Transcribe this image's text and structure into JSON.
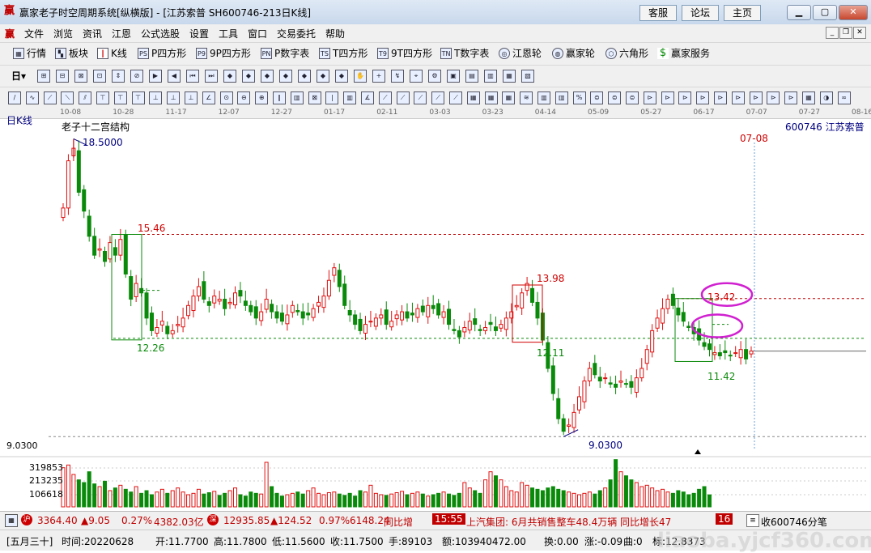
{
  "window": {
    "title": "赢家老子时空周期系统[纵横版] - [江苏索普  SH600746-213日K线]",
    "buttons": [
      "客服",
      "论坛",
      "主页"
    ]
  },
  "menu": [
    "文件",
    "浏览",
    "资讯",
    "江恩",
    "公式选股",
    "设置",
    "工具",
    "窗口",
    "交易委托",
    "帮助"
  ],
  "toolbar1": [
    "行情",
    "板块",
    "K线",
    "P四方形",
    "9P四方形",
    "P数字表",
    "T四方形",
    "9T四方形",
    "T数字表",
    "江恩轮",
    "赢家轮",
    "六角形",
    "赢家服务"
  ],
  "toolbar1_icons": [
    "PS",
    "P9",
    "PN",
    "TS",
    "T9",
    "TN"
  ],
  "date_axis": [
    "10-08",
    "10-28",
    "11-17",
    "12-07",
    "12-27",
    "01-17",
    "02-11",
    "03-03",
    "03-23",
    "04-14",
    "05-09",
    "05-27",
    "06-17",
    "07-07",
    "07-27",
    "08-16"
  ],
  "chart": {
    "period_label": "日K线",
    "indicator_name": "老子十二宫结构",
    "stock_code": "600746",
    "stock_name": "江苏索普",
    "cursor_date": "07-08",
    "price_labels": {
      "high": "18.5000",
      "box1_top": "15.46",
      "box1_bottom": "12.26",
      "box2_top": "13.98",
      "box2_bottom": "12.11",
      "box3_top": "13.42",
      "box3_bottom": "11.42",
      "low": "9.0300",
      "low_axis": "9.0300"
    },
    "volume_ticks": [
      "319853",
      "213235",
      "106618"
    ],
    "colors": {
      "up": "#e01010",
      "down": "#0a8a0a",
      "box": "#0a8a0a",
      "red_box": "#d00000",
      "highlight": "#d020d0",
      "cursor": "#6aa0d8",
      "price_line": "#c00000"
    }
  },
  "chart_data": {
    "type": "candlestick",
    "title": "老子十二宫结构",
    "series": [
      {
        "name": "price_close_path",
        "values": [
          16.3,
          17.8,
          18.2,
          16.8,
          16.2,
          15.4,
          14.8,
          15.0,
          14.6,
          15.2,
          14.8,
          15.3,
          14.2,
          13.4,
          13.9,
          13.6,
          12.8,
          12.4,
          12.5,
          12.7,
          12.3,
          12.4,
          12.6,
          12.8,
          13.2,
          13.5,
          13.8,
          13.4,
          13.2,
          13.5,
          13.4,
          13.1,
          13.3,
          13.6,
          13.5,
          13.2,
          13.0,
          12.8,
          13.0,
          13.4,
          13.0,
          12.8,
          12.7,
          12.9,
          13.2,
          13.0,
          12.8,
          12.9,
          13.1,
          13.3,
          13.5,
          14.0,
          14.4,
          13.8,
          13.2,
          12.9,
          12.6,
          12.4,
          12.6,
          12.7,
          12.8,
          12.9,
          12.6,
          12.7,
          12.9,
          13.0,
          12.8,
          12.9,
          13.1,
          13.0,
          13.2,
          13.1,
          12.9,
          13.0,
          12.6,
          12.4,
          12.2,
          12.5,
          12.7,
          12.6,
          12.4,
          12.5,
          12.6,
          12.4,
          12.6,
          12.8,
          13.0,
          13.2,
          13.6,
          13.9,
          13.3,
          12.8,
          12.1,
          11.2,
          10.4,
          9.6,
          9.2,
          9.4,
          9.8,
          10.3,
          10.8,
          11.2,
          11.0,
          10.8,
          10.9,
          10.7,
          10.6,
          10.8,
          10.7,
          10.6,
          10.9,
          11.2,
          11.8,
          12.4,
          12.8,
          13.1,
          13.4,
          13.2,
          12.9,
          12.7,
          12.5,
          12.3,
          12.1,
          11.9,
          11.8,
          11.7,
          11.6,
          11.7,
          11.6,
          11.7,
          11.8,
          11.5,
          11.75
        ]
      },
      {
        "name": "volume",
        "values": [
          290000,
          310000,
          240000,
          200000,
          180000,
          260000,
          170000,
          150000,
          190000,
          120000,
          140000,
          160000,
          130000,
          110000,
          150000,
          100000,
          120000,
          90000,
          110000,
          130000,
          100000,
          120000,
          140000,
          110000,
          90000,
          100000,
          130000,
          95000,
          105000,
          115000,
          85000,
          100000,
          120000,
          140000,
          90000,
          80000,
          110000,
          100000,
          95000,
          330000,
          150000,
          100000,
          80000,
          90000,
          100000,
          110000,
          95000,
          120000,
          140000,
          100000,
          90000,
          105000,
          110000,
          95000,
          85000,
          100000,
          80000,
          120000,
          110000,
          160000,
          100000,
          90000,
          85000,
          95000,
          105000,
          115000,
          90000,
          100000,
          110000,
          95000,
          80000,
          90000,
          100000,
          110000,
          95000,
          85000,
          100000,
          180000,
          140000,
          120000,
          100000,
          200000,
          260000,
          230000,
          200000,
          150000,
          120000,
          110000,
          180000,
          160000,
          140000,
          130000,
          120000,
          140000,
          150000,
          130000,
          120000,
          110000,
          100000,
          90000,
          100000,
          110000,
          95000,
          120000,
          140000,
          200000,
          350000,
          260000,
          230000,
          200000,
          180000,
          150000,
          160000,
          140000,
          120000,
          130000,
          110000,
          100000,
          120000,
          110000,
          90000,
          100000,
          130000,
          150000,
          89103
        ]
      }
    ],
    "ylim": [
      8.6,
      19.0
    ],
    "reference_lines": [
      15.46,
      13.42,
      12.26,
      11.75,
      9.03
    ]
  },
  "ticker": {
    "sh_index": "3364.40",
    "sh_change": "▲9.05",
    "sh_pct": "0.27%",
    "sh_amount": "4382.03亿",
    "sz_index": "12935.85",
    "sz_change": "▲124.52",
    "sz_pct": "0.97%",
    "sz_amount": "6148.24",
    "news_prefix": "同比增",
    "news_time": "15:55",
    "news_text": "上汽集团: 6月共销售整车48.4万辆 同比增长47",
    "news_suffix": "16",
    "right_label": "收600746分笔"
  },
  "status": {
    "date_label": "[五月三十]",
    "time": "时间:20220628",
    "open": "开:11.7700",
    "high": "高:11.7800",
    "low": "低:11.5600",
    "close": "收:11.7500",
    "hands": "手:89103",
    "amount": "额:103940472.00",
    "turnover": "换:0.00",
    "change": "涨:-0.09",
    "mark": "曲:0",
    "index": "标:12.8373"
  },
  "watermark": "liaoba.yjcf360.com"
}
